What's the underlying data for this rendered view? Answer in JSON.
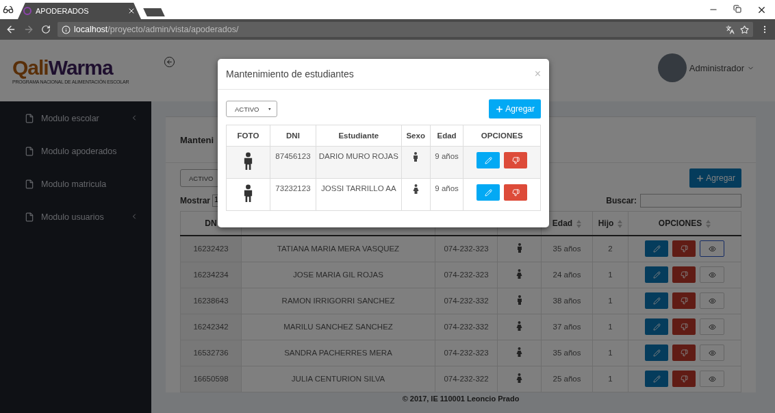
{
  "browser": {
    "tab_title": "APODERADOS",
    "url_host": "localhost",
    "url_path": "/proyecto/admin/vista/apoderados/"
  },
  "logo": {
    "part1": "Qali",
    "part2": "Warma",
    "tagline": "PROGRAMA NACIONAL DE ALIMENTACIÓN ESCOLAR"
  },
  "sidebar": {
    "items": [
      {
        "label": "Modulo escolar",
        "has_submenu": true
      },
      {
        "label": "Modulo apoderados",
        "has_submenu": false
      },
      {
        "label": "Modulo matricula",
        "has_submenu": false
      },
      {
        "label": "Modulo usuarios",
        "has_submenu": true
      }
    ]
  },
  "header": {
    "user": "Administrador"
  },
  "card": {
    "title": "Manteni",
    "filter": "ACTIVO",
    "add_button": "Agregar",
    "show_label": "Mostrar",
    "show_value": "1",
    "search_label": "Buscar:",
    "columns": [
      {
        "label": "DN",
        "sortable": false
      },
      {},
      {},
      {},
      {
        "label": "Edad",
        "sortable": true
      },
      {
        "label": "Hijo",
        "sortable": true
      },
      {
        "label": "OPCIONES",
        "sortable": true
      }
    ],
    "rows": [
      {
        "dni": "16232423",
        "name": "TATIANA MARIA MERA VASQUEZ",
        "phone": "074-232-323",
        "kind": "male",
        "age": "35 años",
        "children": "2",
        "view_focused": true
      },
      {
        "dni": "16234234",
        "name": "JOSE MARIA GIL ROJAS",
        "phone": "074-232-323",
        "kind": "female",
        "age": "24 años",
        "children": "1",
        "view_focused": false
      },
      {
        "dni": "16238643",
        "name": "RAMON IRRIGORRI SANCHEZ",
        "phone": "074-232-332",
        "kind": "male",
        "age": "38 años",
        "children": "1",
        "view_focused": false
      },
      {
        "dni": "16242342",
        "name": "MARILU SANCHEZ SANCHEZ",
        "phone": "074-232-332",
        "kind": "female",
        "age": "37 años",
        "children": "1",
        "view_focused": false
      },
      {
        "dni": "16532736",
        "name": "SANDRA PACHERRES MERA",
        "phone": "074-232-323",
        "kind": "female",
        "age": "35 años",
        "children": "1",
        "view_focused": false
      },
      {
        "dni": "16650598",
        "name": "JULIA CENTURION SILVA",
        "phone": "074-232-322",
        "kind": "female",
        "age": "25 años",
        "children": "1",
        "view_focused": false
      }
    ]
  },
  "modal": {
    "title": "Mantenimiento de estudiantes",
    "close": "×",
    "filter": "ACTIVO",
    "add_button": "Agregar",
    "columns": [
      "FOTO",
      "DNI",
      "Estudiante",
      "Sexo",
      "Edad",
      "OPCIONES"
    ],
    "rows": [
      {
        "dni": "87456123",
        "name": "DARIO MURO ROJAS",
        "kind": "male",
        "age": "9 años"
      },
      {
        "dni": "73232123",
        "name": "JOSSI TARRILLO AA",
        "kind": "female",
        "age": "9 años"
      }
    ]
  },
  "footer": "© 2017, IE 110001 Leoncio Prado"
}
